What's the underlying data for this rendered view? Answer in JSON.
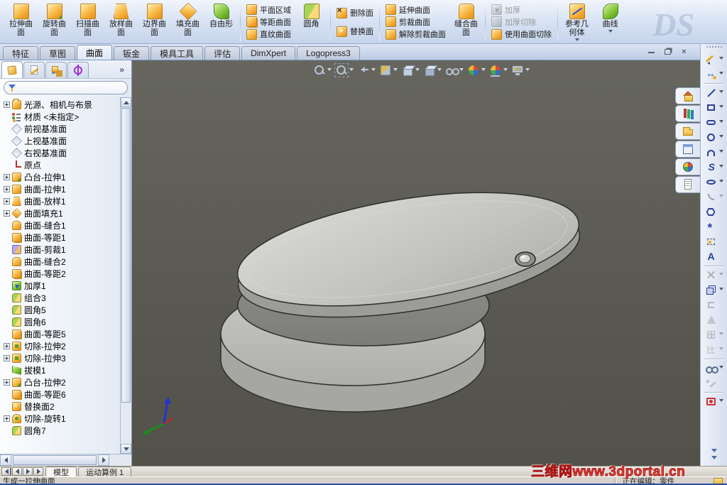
{
  "brand_watermark": "DS",
  "ribbon": {
    "surface_buttons": [
      {
        "label": "拉伸曲面",
        "icon": "extrude-surface-icon"
      },
      {
        "label": "旋转曲面",
        "icon": "revolve-surface-icon"
      },
      {
        "label": "扫描曲面",
        "icon": "sweep-surface-icon"
      },
      {
        "label": "放样曲面",
        "icon": "loft-surface-icon"
      },
      {
        "label": "边界曲面",
        "icon": "boundary-surface-icon"
      },
      {
        "label": "填充曲面",
        "icon": "fill-surface-icon"
      },
      {
        "label": "自由形",
        "icon": "freeform-icon"
      }
    ],
    "col_a": [
      {
        "label": "平面区域",
        "icon": "planar-surface-icon"
      },
      {
        "label": "等距曲面",
        "icon": "offset-surface-icon"
      },
      {
        "label": "直纹曲面",
        "icon": "ruled-surface-icon"
      }
    ],
    "fillet_button": {
      "label": "圆角",
      "icon": "fillet-icon"
    },
    "col_b": [
      {
        "label": "删除面",
        "icon": "delete-face-icon"
      },
      {
        "label": "替换面",
        "icon": "replace-face-icon"
      }
    ],
    "col_c": [
      {
        "label": "延伸曲面",
        "icon": "extend-surface-icon"
      },
      {
        "label": "剪裁曲面",
        "icon": "trim-surface-icon"
      },
      {
        "label": "解除剪裁曲面",
        "icon": "untrim-surface-icon"
      }
    ],
    "knit_button": {
      "label": "缝合曲面",
      "icon": "knit-surface-icon"
    },
    "col_d": [
      {
        "label": "加厚",
        "icon": "thicken-icon",
        "disabled": true
      },
      {
        "label": "加厚切除",
        "icon": "thicken-cut-icon",
        "disabled": true
      },
      {
        "label": "使用曲面切除",
        "icon": "cut-with-surface-icon"
      }
    ],
    "ref_button": {
      "label": "参考几何体",
      "icon": "reference-geometry-icon"
    },
    "curves_button": {
      "label": "曲线",
      "icon": "curves-icon"
    }
  },
  "command_tabs": {
    "items": [
      {
        "label": "特征"
      },
      {
        "label": "草图"
      },
      {
        "label": "曲面",
        "active": true
      },
      {
        "label": "钣金"
      },
      {
        "label": "模具工具"
      },
      {
        "label": "评估"
      },
      {
        "label": "DimXpert"
      },
      {
        "label": "Logopress3"
      }
    ]
  },
  "icons": {
    "close": "×",
    "panel_overflow_chevron": "»"
  },
  "manager_panel": {
    "tabs": [
      {
        "icon": "featuremanager-icon",
        "active": true
      },
      {
        "icon": "propertymanager-icon"
      },
      {
        "icon": "configurationmanager-icon"
      },
      {
        "icon": "dimxpertmanager-icon"
      }
    ],
    "filter_value": ""
  },
  "feature_tree": {
    "items": [
      {
        "label": "光源、相机与布景",
        "icon": "lights-folder-icon",
        "plus": true
      },
      {
        "label": "材质 <未指定>",
        "icon": "material-icon"
      },
      {
        "label": "前视基准面",
        "icon": "plane-icon"
      },
      {
        "label": "上视基准面",
        "icon": "plane-icon"
      },
      {
        "label": "右视基准面",
        "icon": "plane-icon"
      },
      {
        "label": "原点",
        "icon": "origin-icon"
      },
      {
        "label": "凸台-拉伸1",
        "icon": "boss-extrude-icon",
        "plus": true
      },
      {
        "label": "曲面-拉伸1",
        "icon": "surface-extrude-icon",
        "plus": true
      },
      {
        "label": "曲面-放样1",
        "icon": "surface-loft-icon",
        "plus": true
      },
      {
        "label": "曲面填充1",
        "icon": "surface-fill-icon",
        "plus": true
      },
      {
        "label": "曲面-缝合1",
        "icon": "surface-knit-icon"
      },
      {
        "label": "曲面-等距1",
        "icon": "surface-offset-icon"
      },
      {
        "label": "曲面-剪裁1",
        "icon": "surface-trim-icon"
      },
      {
        "label": "曲面-缝合2",
        "icon": "surface-knit-icon"
      },
      {
        "label": "曲面-等距2",
        "icon": "surface-offset-icon"
      },
      {
        "label": "加厚1",
        "icon": "thicken-icon"
      },
      {
        "label": "组合3",
        "icon": "combine-icon"
      },
      {
        "label": "圆角5",
        "icon": "fillet-icon"
      },
      {
        "label": "圆角6",
        "icon": "fillet-icon"
      },
      {
        "label": "曲面-等距5",
        "icon": "surface-offset-icon"
      },
      {
        "label": "切除-拉伸2",
        "icon": "cut-extrude-icon",
        "plus": true
      },
      {
        "label": "切除-拉伸3",
        "icon": "cut-extrude-icon",
        "plus": true
      },
      {
        "label": "拔模1",
        "icon": "draft-icon"
      },
      {
        "label": "凸台-拉伸2",
        "icon": "boss-extrude-icon",
        "plus": true
      },
      {
        "label": "曲面-等距6",
        "icon": "surface-offset-icon"
      },
      {
        "label": "替换面2",
        "icon": "replace-face2-icon"
      },
      {
        "label": "切除-旋转1",
        "icon": "cut-revolve-icon",
        "plus": true
      },
      {
        "label": "圆角7",
        "icon": "fillet-icon"
      }
    ]
  },
  "hud": {
    "items": [
      {
        "icon": "zoom-fit-icon"
      },
      {
        "icon": "zoom-area-icon"
      },
      {
        "icon": "previous-view-icon"
      },
      {
        "icon": "section-view-icon"
      },
      {
        "icon": "view-orientation-icon",
        "dd": true
      },
      {
        "icon": "display-style-icon",
        "dd": true
      },
      {
        "icon": "hide-show-icon",
        "dd": true
      },
      {
        "icon": "edit-appearance-icon"
      },
      {
        "icon": "apply-scene-icon",
        "dd": true
      },
      {
        "icon": "view-settings-icon",
        "dd": true
      }
    ]
  },
  "task_pane": {
    "tabs": [
      {
        "icon": "home-icon"
      },
      {
        "icon": "design-library-icon"
      },
      {
        "icon": "file-explorer-icon"
      },
      {
        "icon": "view-palette-icon"
      },
      {
        "icon": "appearances-icon"
      },
      {
        "icon": "custom-properties-icon"
      }
    ]
  },
  "sketch_toolbar": {
    "items": [
      {
        "icon": "sketch-icon",
        "dd": true
      },
      {
        "icon": "smart-dimension-icon",
        "dd": true
      },
      {
        "divider": true
      },
      {
        "icon": "line-icon",
        "dd": true
      },
      {
        "icon": "rectangle-icon",
        "dd": true
      },
      {
        "icon": "slot-icon",
        "dd": true
      },
      {
        "icon": "circle-icon",
        "dd": true
      },
      {
        "icon": "arc-icon",
        "dd": true
      },
      {
        "icon": "spline-icon",
        "dd": true
      },
      {
        "icon": "ellipse-icon",
        "dd": true
      },
      {
        "icon": "sketch-fillet-icon",
        "dd": true,
        "disabled": true
      },
      {
        "icon": "polygon-icon"
      },
      {
        "icon": "point-icon"
      },
      {
        "icon": "mirror-entities-icon"
      },
      {
        "icon": "text-icon"
      },
      {
        "divider": true
      },
      {
        "icon": "trim-entities-icon",
        "dd": true,
        "disabled": true
      },
      {
        "icon": "box-3d-icon",
        "dd": true
      },
      {
        "icon": "convert-entities-icon",
        "disabled": true
      },
      {
        "icon": "draft-warning-icon",
        "disabled": true
      },
      {
        "icon": "linear-pattern-icon",
        "dd": true,
        "disabled": true
      },
      {
        "icon": "sketch-pattern-icon",
        "dd": true,
        "disabled": true
      },
      {
        "divider": true
      },
      {
        "icon": "instant3d-icon",
        "dd": true
      },
      {
        "icon": "ink-sketch-icon",
        "disabled": true
      },
      {
        "divider": true
      },
      {
        "icon": "screen-capture-icon",
        "dd": true
      }
    ]
  },
  "motion_bar": {
    "tabs": [
      {
        "label": "模型",
        "active": true
      },
      {
        "label": "运动算例 1"
      }
    ]
  },
  "status_bar": {
    "left": "生成一拉伸曲面",
    "right": "正在编辑：零件"
  },
  "watermark": {
    "text": "三维网www.3dportal.cn",
    "color": "#df4a3c"
  },
  "viewport": {
    "background": "#5a5a52",
    "model_color": "#c4c4c0"
  }
}
